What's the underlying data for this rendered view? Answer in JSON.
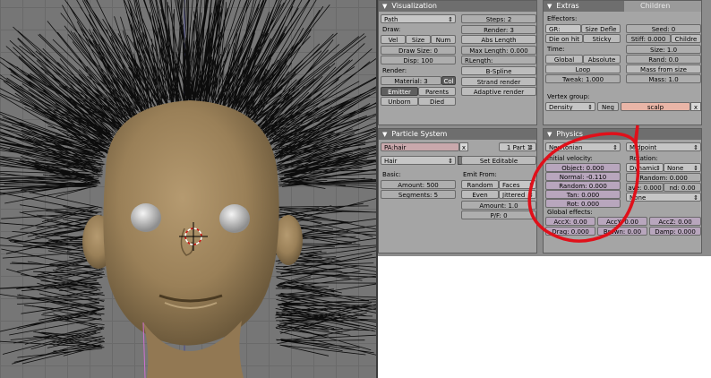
{
  "visualization": {
    "title": "Visualization",
    "path_select": "Path",
    "draw_label": "Draw:",
    "vel": "Vel",
    "size": "Size",
    "num": "Num",
    "draw_size": "Draw Size: 0",
    "disp": "Disp: 100",
    "render_label": "Render:",
    "material": "Material: 3",
    "col": "Col",
    "emitter": "Emitter",
    "parents": "Parents",
    "unborn": "Unborn",
    "died": "Died",
    "steps": "Steps: 2",
    "render_num": "Render: 3",
    "abs_length": "Abs Length",
    "max_length": "Max Length: 0.000",
    "rlength": "RLength:",
    "bspline": "B-Spline",
    "strand_render": "Strand render",
    "adaptive_render": "Adaptive render"
  },
  "extras": {
    "tab_extras": "Extras",
    "tab_children": "Children",
    "effectors_label": "Effectors:",
    "gr": "GR:",
    "size_defl": "Size Defle",
    "die_on_hit": "Die on hit",
    "sticky": "Sticky",
    "time_label": "Time:",
    "global": "Global",
    "absolute": "Absolute",
    "loop": "Loop",
    "tweak": "Tweak: 1.000",
    "seed": "Seed: 0",
    "stiff": "Stiff: 0.000",
    "childre": "Childre",
    "size_val": "Size: 1.0",
    "rand": "Rand: 0.0",
    "mass_from_size": "Mass from size",
    "mass": "Mass: 1.0",
    "vertex_group_label": "Vertex group:",
    "density": "Density",
    "neg": "Neg",
    "scalp": "scalp",
    "x": "x"
  },
  "particle_system": {
    "title": "Particle System",
    "name": "PA:hair",
    "x": "x",
    "part": "1 Part 1",
    "type": "Hair",
    "set_editable": "Set Editable",
    "basic_label": "Basic:",
    "amount": "Amount: 500",
    "segments": "Segments: 5",
    "emit_from_label": "Emit From:",
    "random": "Random",
    "faces": "Faces",
    "even": "Even",
    "jittered": "Jittered",
    "amount2": "Amount: 1.0",
    "pf": "P/F: 0"
  },
  "physics": {
    "title": "Physics",
    "newtonian": "Newtonian",
    "midpoint": "Midpoint",
    "initial_velocity_label": "Initial velocity:",
    "object": "Object: 0.000",
    "normal": "Normal: -0.110",
    "random": "Random: 0.000",
    "tan": "Tan: 0.000",
    "rot": "Rot: 0.000",
    "global_effects_label": "Global effects:",
    "accx": "AccX: 0.00",
    "accy": "AccY: 0.00",
    "accz": "AccZ: 0.00",
    "drag": "Drag: 0.000",
    "brown": "Brown: 0.00",
    "damp": "Damp: 0.000",
    "rotation_label": "Rotation:",
    "dynamic": "Dynamic",
    "none1": "None",
    "rot_random": "Random: 0.000",
    "ave": "ave: 0.000",
    "nd": "nd: 0.00",
    "none2": "None"
  },
  "colors": {
    "panel_bg": "#a5a5a5",
    "header_bg": "#6e6e6e",
    "annotation_red": "#e0101a",
    "skin": "#a38963"
  }
}
